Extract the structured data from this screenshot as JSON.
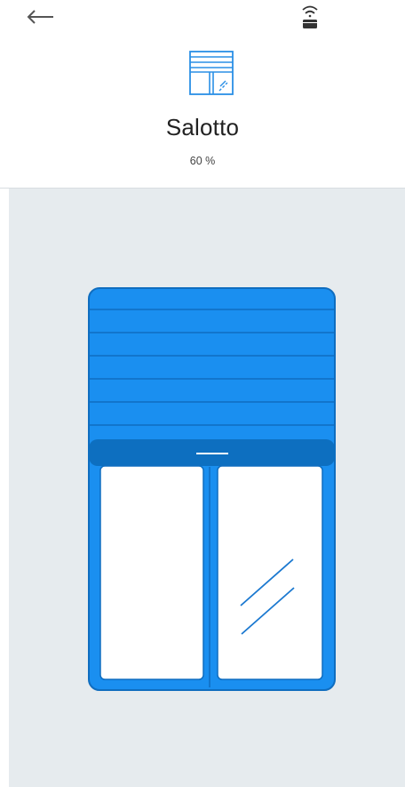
{
  "topbar": {
    "back_icon": "arrow-left-icon",
    "gateway_icon": "wireless-gateway-icon"
  },
  "device": {
    "icon": "roller-shutter-window-icon",
    "name": "Salotto",
    "position_label": "60 %",
    "position_percent": 60
  },
  "colors": {
    "accent": "#1a8ff0",
    "accent_dark": "#0d6fc0",
    "stage_bg": "#e6ebee",
    "outline": "#0f6dbf"
  }
}
